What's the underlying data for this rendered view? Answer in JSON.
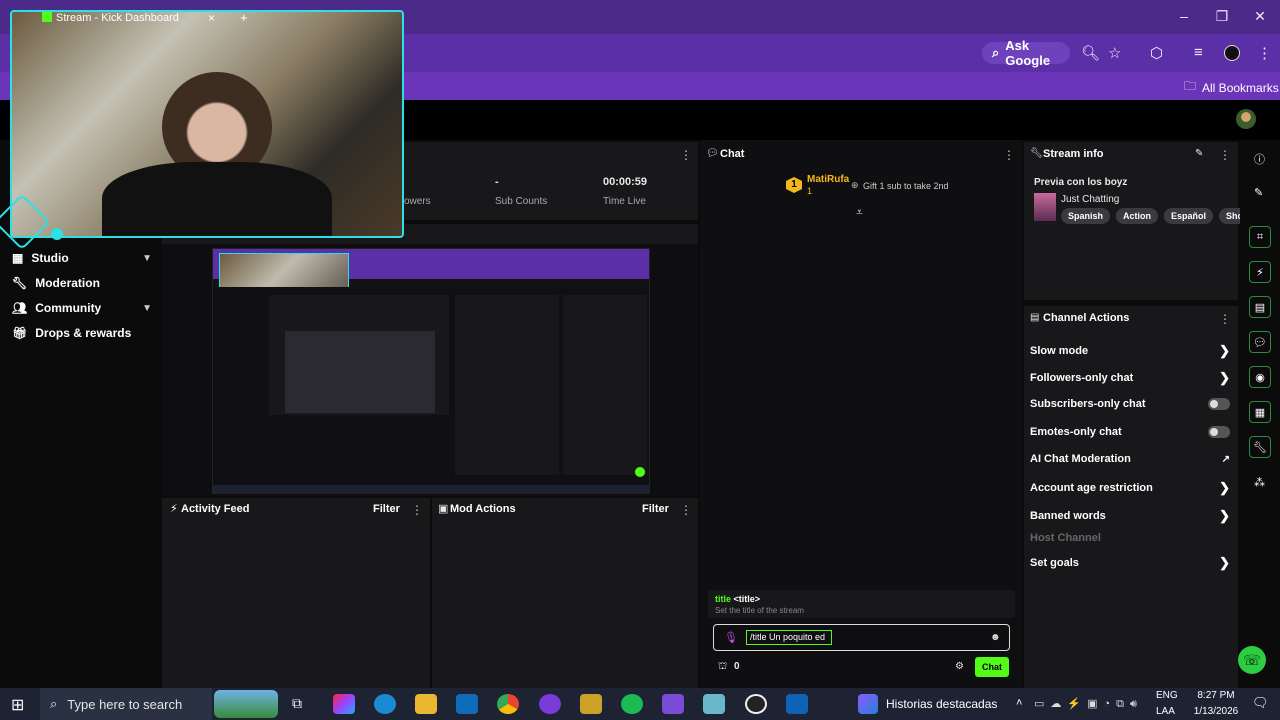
{
  "browser": {
    "tab_title": "Stream - Kick Dashboard",
    "tab_close": "×",
    "new_tab": "+",
    "ask_google": "Ask Google",
    "all_bookmarks": "All Bookmarks",
    "window": {
      "minimize": "–",
      "restore": "❐",
      "close": "✕"
    }
  },
  "sidebar": {
    "items": [
      {
        "label": "Studio",
        "icon": "studio-icon",
        "has_chevron": true
      },
      {
        "label": "Moderation",
        "icon": "wrench-icon",
        "has_chevron": false
      },
      {
        "label": "Community",
        "icon": "users-icon",
        "has_chevron": true
      },
      {
        "label": "Drops & rewards",
        "icon": "gift-icon",
        "has_chevron": false
      }
    ]
  },
  "stats": {
    "followers_label": "owers",
    "sub_counts_value": "-",
    "sub_counts_label": "Sub Counts",
    "time_live_value": "00:00:59",
    "time_live_label": "Time Live"
  },
  "activity_feed": {
    "title": "Activity Feed",
    "filter": "Filter"
  },
  "mod_actions": {
    "title": "Mod Actions",
    "filter": "Filter"
  },
  "chat": {
    "title": "Chat",
    "top_gifter": {
      "rank": "1",
      "name": "MatiRufa",
      "count": "1",
      "hint": "Gift 1 sub to take 2nd"
    },
    "command_name": "title",
    "command_arg": "<title>",
    "command_desc": "Set the title of the stream",
    "input_value": "/title Un poquito ed",
    "points": "0",
    "send_button": "Chat"
  },
  "stream_info": {
    "title": "Stream info",
    "stream_title": "Previa con los boyz",
    "category": "Just Chatting",
    "tags": [
      "Spanish",
      "Action",
      "Español",
      "Shooter"
    ]
  },
  "channel_actions": {
    "title": "Channel Actions",
    "items": [
      {
        "label": "Slow mode",
        "control": "arrow"
      },
      {
        "label": "Followers-only chat",
        "control": "arrow"
      },
      {
        "label": "Subscribers-only chat",
        "control": "toggle"
      },
      {
        "label": "Emotes-only chat",
        "control": "toggle"
      },
      {
        "label": "AI Chat Moderation",
        "control": "external"
      },
      {
        "label": "Account age restriction",
        "control": "arrow"
      },
      {
        "label": "Banned words",
        "control": "arrow"
      },
      {
        "label": "Host Channel",
        "control": "none",
        "disabled": true
      },
      {
        "label": "Set goals",
        "control": "arrow"
      }
    ]
  },
  "taskbar": {
    "search_placeholder": "Type here to search",
    "pinned_label": "Historias destacadas",
    "lang_top": "ENG",
    "lang_bottom": "LAA",
    "time": "8:27 PM",
    "date": "1/13/2026"
  },
  "colors": {
    "kick_green": "#53fc18",
    "purple_chrome": "#5b2fa5",
    "panel_bg": "#18181b"
  }
}
